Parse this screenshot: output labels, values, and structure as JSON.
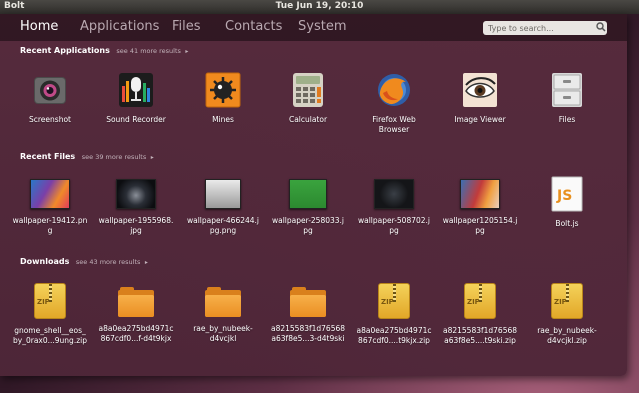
{
  "topbar": {
    "app_name": "Bolt",
    "clock": "Tue Jun 19, 20:10"
  },
  "nav": {
    "tabs": [
      "Home",
      "Applications",
      "Files",
      "Contacts",
      "System"
    ],
    "active": "Home"
  },
  "search": {
    "placeholder": "Type to search..."
  },
  "sections": {
    "applications": {
      "title": "Recent Applications",
      "more": "see 41 more results",
      "items": [
        "Screenshot",
        "Sound Recorder",
        "Mines",
        "Calculator",
        "Firefox Web\nBrowser",
        "Image Viewer",
        "Files"
      ]
    },
    "files": {
      "title": "Recent Files",
      "more": "see 39 more results",
      "items": [
        "wallpaper-19412.pn\ng",
        "wallpaper-1955968.\njpg",
        "wallpaper-466244.j\npg.png",
        "wallpaper-258033.j\npg",
        "wallpaper-508702.j\npg",
        "wallpaper1205154.j\npg",
        "Bolt.js"
      ]
    },
    "downloads": {
      "title": "Downloads",
      "more": "see 43 more results",
      "items": [
        "gnome_shell__eos_\nby_0rax0...9ung.zip",
        "a8a0ea275bd4971c\n867cdf0...f-d4t9kjx",
        "rae_by_nubeek-\nd4vcjkl",
        "a8215583f1d76568\na63f8e5...3-d4t9ski",
        "a8a0ea275bd4971c\n867cdf0....t9kjx.zip",
        "a8215583f1d76568\na63f8e5....t9ski.zip",
        "rae_by_nubeek-\nd4vcjkl.zip"
      ]
    }
  },
  "icons": {
    "applications": [
      "camera-icon",
      "sound-recorder-icon",
      "mines-icon",
      "calculator-icon",
      "firefox-icon",
      "image-viewer-icon",
      "files-cabinet-icon"
    ],
    "files": [
      "thumbnail",
      "thumbnail",
      "thumbnail",
      "thumbnail",
      "thumbnail",
      "thumbnail",
      "js-file-icon"
    ],
    "downloads": [
      "zip-icon",
      "folder-icon",
      "folder-icon",
      "folder-icon",
      "zip-icon",
      "zip-icon",
      "zip-icon"
    ],
    "section_arrow": "▸"
  },
  "colors": {
    "dash_bg": "#582c3e",
    "accent": "#ffffff"
  }
}
